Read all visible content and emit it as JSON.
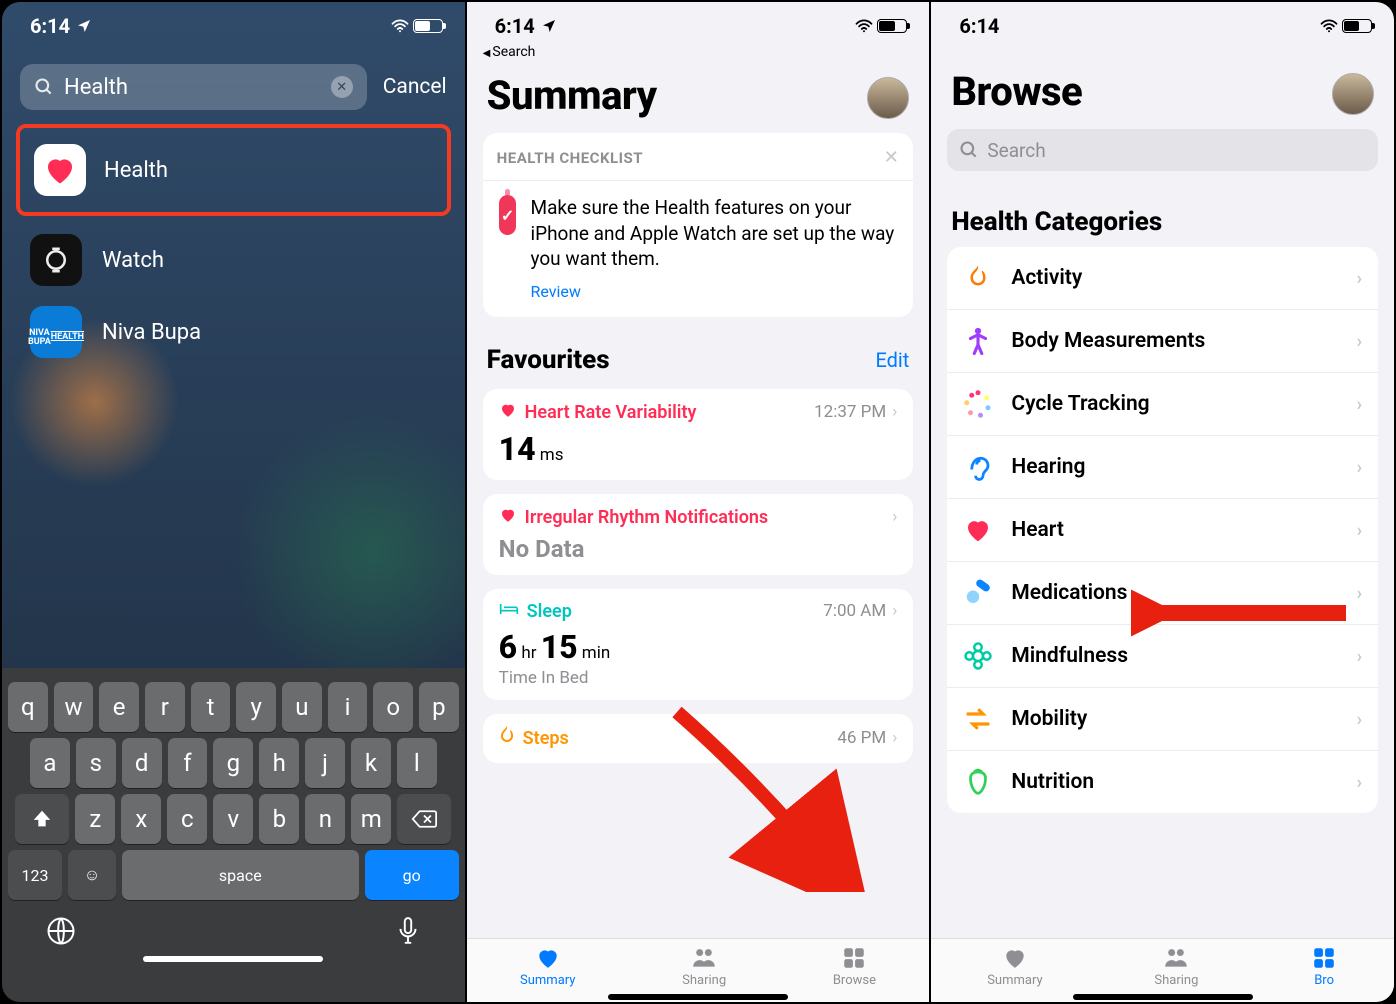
{
  "pane0": {
    "time": "6:14",
    "search_value": "Health",
    "cancel": "Cancel",
    "results": [
      {
        "name": "Health"
      },
      {
        "name": "Watch"
      },
      {
        "name": "Niva Bupa"
      }
    ],
    "niva_icon_line1": "NIVA BUPA",
    "niva_icon_line2": "HEALTH",
    "keys_row1": [
      "q",
      "w",
      "e",
      "r",
      "t",
      "y",
      "u",
      "i",
      "o",
      "p"
    ],
    "keys_row2": [
      "a",
      "s",
      "d",
      "f",
      "g",
      "h",
      "j",
      "k",
      "l"
    ],
    "keys_row3": [
      "z",
      "x",
      "c",
      "v",
      "b",
      "n",
      "m"
    ],
    "key_123": "123",
    "key_space": "space",
    "key_go": "go"
  },
  "pane1": {
    "time": "6:14",
    "back": "Search",
    "title": "Summary",
    "checklist_header": "HEALTH CHECKLIST",
    "checklist_msg": "Make sure the Health features on your iPhone and Apple Watch are set up the way you want them.",
    "review": "Review",
    "fav_header": "Favourites",
    "edit": "Edit",
    "fav_items": [
      {
        "title": "Heart Rate Variability",
        "time": "12:37 PM",
        "value": "14",
        "unit": "ms",
        "tone": "pink",
        "icon": "heart"
      },
      {
        "title": "Irregular Rhythm Notifications",
        "value_text": "No Data",
        "tone": "pink",
        "icon": "heart"
      },
      {
        "title": "Sleep",
        "time": "7:00 AM",
        "value_rich": "6 hr 15 min",
        "sub": "Time In Bed",
        "tone": "teal",
        "icon": "bed"
      },
      {
        "title": "Steps",
        "time": "46 PM",
        "tone": "orange",
        "icon": "flame"
      }
    ],
    "tabs": {
      "summary": "Summary",
      "sharing": "Sharing",
      "browse": "Browse"
    }
  },
  "pane2": {
    "time": "6:14",
    "title": "Browse",
    "search_placeholder": "Search",
    "section": "Health Categories",
    "categories": [
      {
        "label": "Activity",
        "color": "#ff7a00"
      },
      {
        "label": "Body Measurements",
        "color": "#a13cff"
      },
      {
        "label": "Cycle Tracking",
        "color": "#ff3570"
      },
      {
        "label": "Hearing",
        "color": "#0a84ff"
      },
      {
        "label": "Heart",
        "color": "#ff2d55"
      },
      {
        "label": "Medications",
        "color": "#4aa7ff"
      },
      {
        "label": "Mindfulness",
        "color": "#00cca1"
      },
      {
        "label": "Mobility",
        "color": "#ff9500"
      },
      {
        "label": "Nutrition",
        "color": "#30d158"
      }
    ],
    "tabs": {
      "summary": "Summary",
      "sharing": "Sharing",
      "browse": "Bro"
    }
  }
}
